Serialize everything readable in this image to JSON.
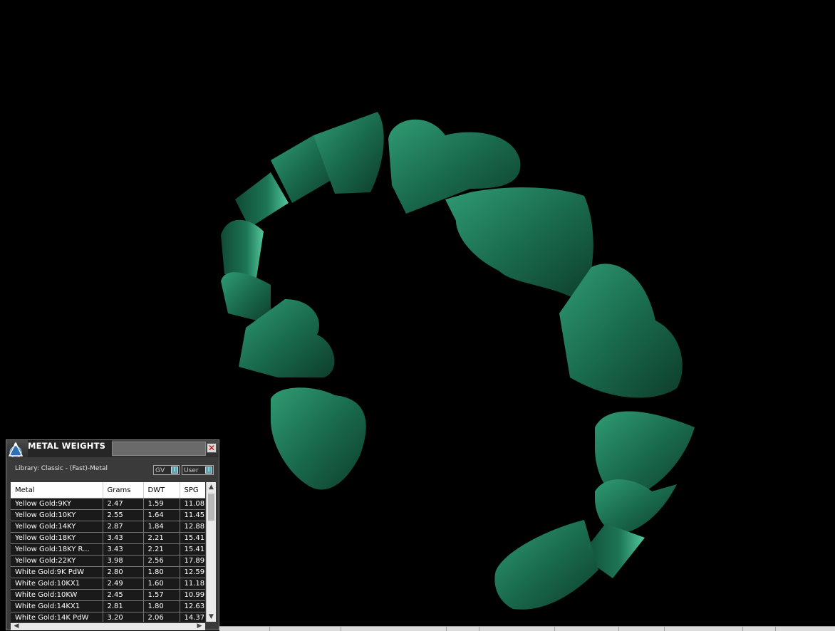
{
  "panel": {
    "title": "METAL WEIGHTS",
    "close_glyph": "✕",
    "library_label": "Library: Classic - (Fast)-Metal",
    "toggle_gv": "GV",
    "toggle_user": "User",
    "toggle_knob": "I",
    "columns": [
      "Metal",
      "Grams",
      "DWT",
      "SPG"
    ],
    "rows": [
      [
        "Yellow Gold:9KY",
        "2.47",
        "1.59",
        "11.08"
      ],
      [
        "Yellow Gold:10KY",
        "2.55",
        "1.64",
        "11.45"
      ],
      [
        "Yellow Gold:14KY",
        "2.87",
        "1.84",
        "12.88"
      ],
      [
        "Yellow Gold:18KY",
        "3.43",
        "2.21",
        "15.41"
      ],
      [
        "Yellow Gold:18KY R...",
        "3.43",
        "2.21",
        "15.41"
      ],
      [
        "Yellow Gold:22KY",
        "3.98",
        "2.56",
        "17.89"
      ],
      [
        "White Gold:9K PdW",
        "2.80",
        "1.80",
        "12.59"
      ],
      [
        "White Gold:10KX1",
        "2.49",
        "1.60",
        "11.18"
      ],
      [
        "White Gold:10KW",
        "2.45",
        "1.57",
        "10.99"
      ],
      [
        "White Gold:14KX1",
        "2.81",
        "1.80",
        "12.63"
      ],
      [
        "White Gold:14K PdW",
        "3.20",
        "2.06",
        "14.37"
      ]
    ],
    "scroll_up": "▲",
    "scroll_down": "▼",
    "scroll_left": "◀",
    "scroll_right": "▶"
  },
  "viewport": {
    "background": "#000000",
    "model_color": "#1f7a5a",
    "model_highlight": "#5fd3a8",
    "model_shadow": "#0b3a2a",
    "model_icon": "heart-ring-model"
  },
  "colors": {
    "panel_bg": "#3a3a3a",
    "logo_blue": "#2f6fb7"
  }
}
